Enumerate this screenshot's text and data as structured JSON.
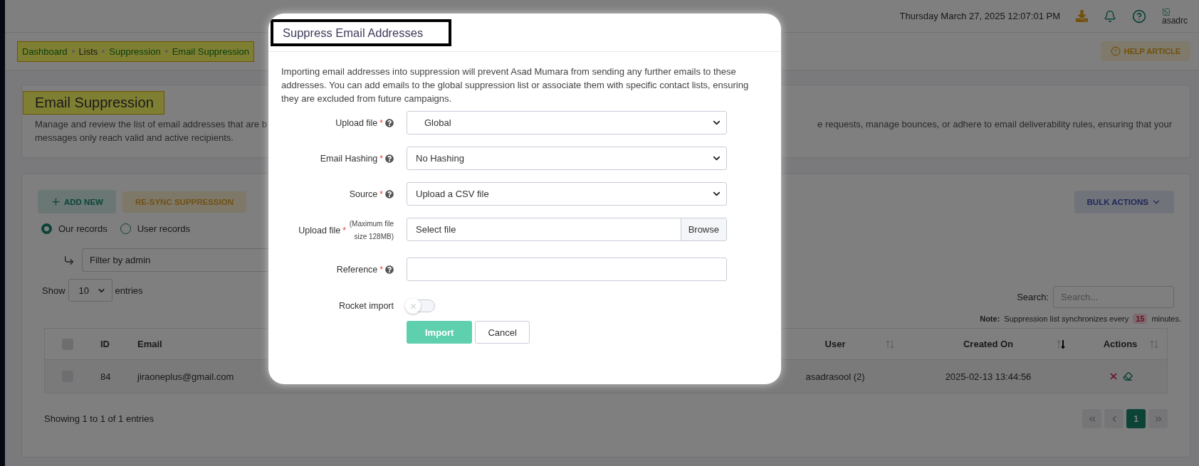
{
  "topbar": {
    "datetime": "Thursday March 27, 2025 12:07:01 PM",
    "avatar_text": "asadrc"
  },
  "breadcrumb": {
    "items": [
      {
        "label": "Dashboard",
        "link": true
      },
      {
        "label": "Lists",
        "link": false
      },
      {
        "label": "Suppression",
        "link": true
      },
      {
        "label": "Email Suppression",
        "link": true
      }
    ],
    "help": "HELP ARTICLE"
  },
  "header": {
    "title": "Email Suppression",
    "description_left": "Manage and review the list of email addresses that are b",
    "description_right": "e requests, manage bounces, or adhere to email deliverability rules, ensuring that your",
    "description_line2": "messages only reach valid and active recipients."
  },
  "toolbar": {
    "add": "ADD NEW",
    "resync": "RE-SYNC SUPPRESSION",
    "bulk": "BULK ACTIONS"
  },
  "records": [
    {
      "label": "Our records",
      "selected": true
    },
    {
      "label": "User records",
      "selected": false
    }
  ],
  "filter": {
    "placeholder": "Filter by admin"
  },
  "length": {
    "before": "Show",
    "value": "10",
    "after": "entries"
  },
  "search": {
    "label": "Search:",
    "placeholder": "Search..."
  },
  "note": {
    "label": "Note:",
    "before": "Suppression list synchronizes every",
    "badge": "15",
    "after": "minutes."
  },
  "table": {
    "header_checked": false,
    "columns": [
      {
        "label": "ID"
      },
      {
        "label": "Email"
      },
      {
        "label": "User",
        "sortable": true,
        "sorted_desc": false
      },
      {
        "label": "Created On",
        "sortable": true,
        "sorted_desc": true
      },
      {
        "label": "Actions",
        "sortable": true,
        "sorted_desc": false
      }
    ],
    "rows": [
      {
        "checked": false,
        "id": "84",
        "email": "jiraoneplus@gmail.com",
        "user": "asadrasool (2)",
        "created": "2025-02-13 13:44:56"
      }
    ]
  },
  "info": "Showing 1 to 1 of 1 entries",
  "pagination": [
    {
      "kind": "first"
    },
    {
      "kind": "prev"
    },
    {
      "kind": "page",
      "label": "1",
      "selected": true
    },
    {
      "kind": "next"
    }
  ],
  "modal": {
    "title": "Suppress Email Addresses",
    "description": "Importing email addresses into suppression will prevent Asad Mumara from sending any further emails to these addresses. You can add emails to the global suppression list or associate them with specific contact lists, ensuring they are excluded from future campaigns.",
    "fields": [
      {
        "kind": "select",
        "label": "Upload file",
        "marker": "*",
        "help": true,
        "value": "Global",
        "indent": true
      },
      {
        "kind": "select",
        "label": "Email Hashing",
        "marker": "*",
        "help": true,
        "value": "No Hashing",
        "indent": false
      },
      {
        "kind": "select",
        "label": "Source",
        "marker": "*",
        "help": true,
        "value": "Upload a CSV file",
        "indent": false
      },
      {
        "kind": "file",
        "label": "Upload file",
        "marker": "*",
        "note": "(Maximum file size 128MB)",
        "value": "Select file",
        "button": "Browse"
      },
      {
        "kind": "text",
        "label": "Reference",
        "marker": "*",
        "help": true
      },
      {
        "kind": "toggle",
        "label": "Rocket import",
        "on": false
      }
    ],
    "buttons": [
      {
        "label": "Import",
        "kind": "primary"
      },
      {
        "label": "Cancel",
        "kind": "secondary"
      }
    ]
  }
}
